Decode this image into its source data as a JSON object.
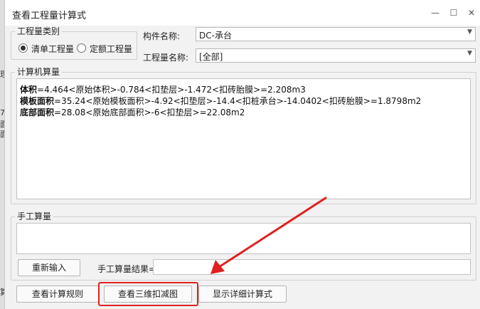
{
  "window": {
    "title": "查看工程量计算式",
    "minimize": "—",
    "maximize": "☐",
    "close": "✕"
  },
  "background_fragments": [
    "理",
    "7",
    "面",
    "面",
    "算"
  ],
  "qty_type": {
    "legend": "工程量类别",
    "options": [
      {
        "label": "清单工程量",
        "selected": true
      },
      {
        "label": "定额工程量",
        "selected": false
      }
    ]
  },
  "component": {
    "label": "构件名称:",
    "value": "DC-承台"
  },
  "qty_name": {
    "label": "工程量名称:",
    "value": "[全部]"
  },
  "computer_calc": {
    "legend": "计算机算量",
    "lines": [
      {
        "name": "体积",
        "formula": "=4.464<原始体积>-0.784<扣垫层>-1.472<扣砖胎膜>=2.208m3"
      },
      {
        "name": "模板面积",
        "formula": "=35.24<原始模板面积>-4.92<扣垫层>-14.4<扣桩承台>-14.0402<扣砖胎膜>=1.8798m2"
      },
      {
        "name": "底部面积",
        "formula": "=28.08<原始底部面积>-6<扣垫层>=22.08m2"
      }
    ]
  },
  "manual_calc": {
    "legend": "手工算量",
    "reenter_button": "重新输入",
    "result_label": "手工算量结果=",
    "result_value": ""
  },
  "footer_buttons": {
    "rules": "查看计算规则",
    "view_3d": "查看三维扣减图",
    "detail": "显示详细计算式"
  },
  "annotation_color": "#e02020"
}
